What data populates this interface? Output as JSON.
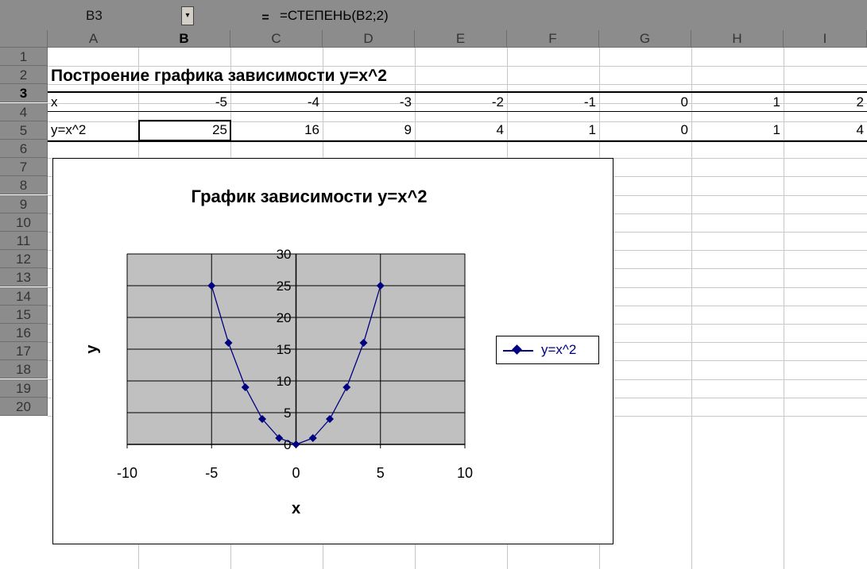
{
  "formula_bar": {
    "name_box": "B3",
    "equals": "=",
    "formula": "=СТЕПЕНЬ(B2;2)"
  },
  "columns": [
    "A",
    "B",
    "C",
    "D",
    "E",
    "F",
    "G",
    "H",
    "I"
  ],
  "rows": [
    "1",
    "2",
    "3",
    "4",
    "5",
    "6",
    "7",
    "8",
    "9",
    "10",
    "11",
    "12",
    "13",
    "14",
    "15",
    "16",
    "17",
    "18",
    "19",
    "20"
  ],
  "sheet": {
    "title": "Построение графика зависимости y=x^2",
    "row2_label": "x",
    "row3_label": "y=x^2",
    "x_values": [
      "-5",
      "-4",
      "-3",
      "-2",
      "-1",
      "0",
      "1",
      "2"
    ],
    "y_values": [
      "25",
      "16",
      "9",
      "4",
      "1",
      "0",
      "1",
      "4"
    ]
  },
  "chart_data": {
    "type": "line",
    "title": "График зависимости y=x^2",
    "xlabel": "x",
    "ylabel": "y",
    "xlim": [
      -10,
      10
    ],
    "ylim": [
      0,
      30
    ],
    "xticks": [
      -10,
      -5,
      0,
      5,
      10
    ],
    "yticks": [
      0,
      5,
      10,
      15,
      20,
      25,
      30
    ],
    "grid": true,
    "legend_position": "right",
    "plot_background": "#c0c0c0",
    "series": [
      {
        "name": "y=x^2",
        "color": "#000080",
        "marker": "diamond",
        "x": [
          -5,
          -4,
          -3,
          -2,
          -1,
          0,
          1,
          2,
          3,
          4,
          5
        ],
        "y": [
          25,
          16,
          9,
          4,
          1,
          0,
          1,
          4,
          9,
          16,
          25
        ]
      }
    ]
  }
}
